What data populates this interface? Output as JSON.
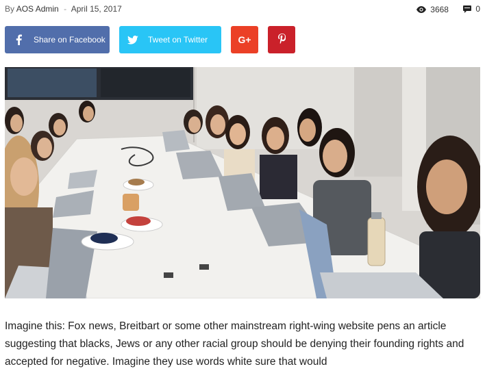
{
  "meta": {
    "by_label": "By",
    "author": "AOS Admin",
    "separator": "-",
    "date": "April 15, 2017",
    "views": "3668",
    "comments": "0",
    "views_icon": "eye-icon",
    "comments_icon": "comment-icon"
  },
  "share": {
    "facebook_label": "Share on Facebook",
    "twitter_label": "Tweet on Twitter",
    "googleplus_glyph": "G+",
    "pinterest_icon": "pinterest-icon",
    "colors": {
      "facebook": "#516eab",
      "twitter": "#29c5f6",
      "googleplus": "#eb4026",
      "pinterest": "#ca212a"
    }
  },
  "photo": {
    "subject": "photo-conference-table"
  },
  "article": {
    "intro": "Imagine this: Fox news, Breitbart or some other mainstream right-wing website pens an article suggesting that blacks, Jews or any other racial group should be denying their founding rights and accepted for negative. Imagine they use words white sure that would"
  }
}
